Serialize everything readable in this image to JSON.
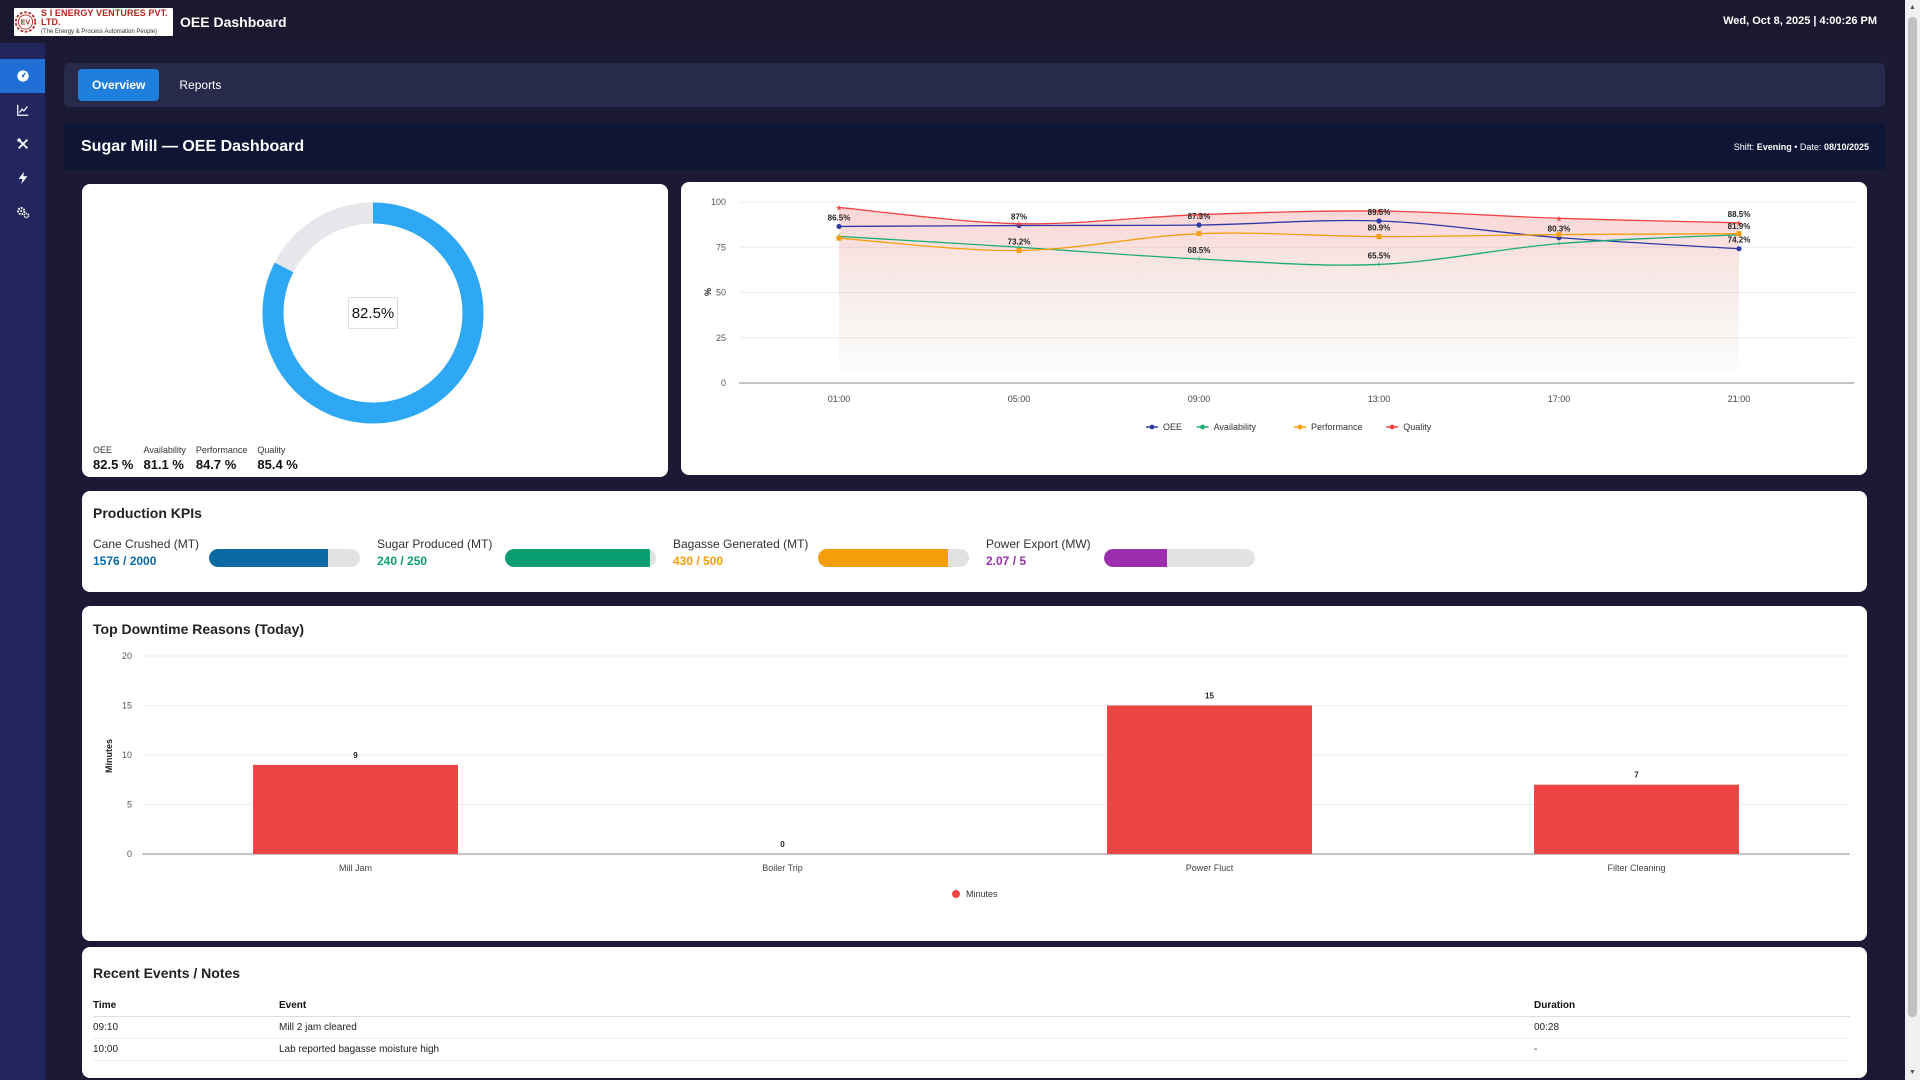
{
  "header": {
    "company_name": "S I ENERGY VENTURES PVT. LTD.",
    "company_tagline": "(The Energy & Process Automation People)",
    "logo_letters": "EV",
    "app_title": "OEE Dashboard",
    "datetime": "Wed, Oct 8, 2025 | 4:00:26 PM"
  },
  "sidebar": {
    "items": [
      {
        "icon": "dashboard-icon",
        "active": true
      },
      {
        "icon": "chart-line-icon",
        "active": false
      },
      {
        "icon": "tools-icon",
        "active": false
      },
      {
        "icon": "bolt-icon",
        "active": false
      },
      {
        "icon": "cogs-icon",
        "active": false
      }
    ]
  },
  "tabs": [
    {
      "label": "Overview",
      "active": true
    },
    {
      "label": "Reports",
      "active": false
    }
  ],
  "page": {
    "title": "Sugar Mill — OEE Dashboard",
    "shift_label": "Shift:",
    "shift_value": "Evening",
    "date_label": "• Date:",
    "date_value": "08/10/2025"
  },
  "gauge": {
    "value": 82.5,
    "value_text": "82.5%",
    "color": "#2ea8f5",
    "track_color": "#e5e7eb",
    "metrics": [
      {
        "label": "OEE",
        "value": "82.5 %"
      },
      {
        "label": "Availability",
        "value": "81.1 %"
      },
      {
        "label": "Performance",
        "value": "84.7 %"
      },
      {
        "label": "Quality",
        "value": "85.4 %"
      }
    ]
  },
  "kpis": {
    "title": "Production KPIs",
    "items": [
      {
        "label": "Cane Crushed (MT)",
        "value": "1576 / 2000",
        "current": 1576,
        "target": 2000,
        "color": "#0b6aa3"
      },
      {
        "label": "Sugar Produced (MT)",
        "value": "240 / 250",
        "current": 240,
        "target": 250,
        "color": "#0b9e73"
      },
      {
        "label": "Bagasse Generated (MT)",
        "value": "430 / 500",
        "current": 430,
        "target": 500,
        "color": "#f59e0b"
      },
      {
        "label": "Power Export (MW)",
        "value": "2.07 / 5",
        "current": 2.07,
        "target": 5,
        "color": "#9b2fae"
      }
    ]
  },
  "chart_data": [
    {
      "type": "line",
      "title": "",
      "xlabel": "",
      "ylabel": "%",
      "ylim": [
        0,
        100
      ],
      "yticks": [
        "0",
        "25",
        "50",
        "75",
        "100"
      ],
      "x": [
        "01:00",
        "05:00",
        "09:00",
        "13:00",
        "17:00",
        "21:00"
      ],
      "legend_position": "bottom",
      "grid": true,
      "series": [
        {
          "name": "OEE",
          "color": "#2f3aa6",
          "values": [
            86.5,
            87,
            87.3,
            89.5,
            80.3,
            74.2
          ]
        },
        {
          "name": "Availability",
          "color": "#1aab72",
          "values": [
            81,
            75,
            68.5,
            65.5,
            77,
            81.9
          ]
        },
        {
          "name": "Performance",
          "color": "#f59e0b",
          "values": [
            80,
            73.2,
            82.5,
            80.9,
            82,
            82.5
          ]
        },
        {
          "name": "Quality",
          "color": "#ef4444",
          "values": [
            97,
            88,
            93,
            95,
            91,
            88.5
          ]
        }
      ],
      "data_labels": [
        {
          "x": "01:00",
          "text": "86.5%"
        },
        {
          "x": "05:00",
          "text": "87%"
        },
        {
          "x": "05:00",
          "text": "73.2%"
        },
        {
          "x": "09:00",
          "text": "87.3%"
        },
        {
          "x": "09:00",
          "text": "68.5%"
        },
        {
          "x": "13:00",
          "text": "89.5%"
        },
        {
          "x": "13:00",
          "text": "80.9%"
        },
        {
          "x": "13:00",
          "text": "65.5%"
        },
        {
          "x": "17:00",
          "text": "80.3%"
        },
        {
          "x": "21:00",
          "text": "88.5%"
        },
        {
          "x": "21:00",
          "text": "81.9%"
        },
        {
          "x": "21:00",
          "text": "74.2%"
        }
      ]
    },
    {
      "type": "bar",
      "title": "Top Downtime Reasons (Today)",
      "xlabel": "",
      "ylabel": "Minutes",
      "ylim": [
        0,
        20
      ],
      "yticks": [
        "0",
        "5",
        "10",
        "15",
        "20"
      ],
      "categories": [
        "Mill Jam",
        "Boiler Trip",
        "Power Fluct",
        "Filter Cleaning"
      ],
      "series": [
        {
          "name": "Minutes",
          "color": "#ef4444",
          "values": [
            9,
            0,
            15,
            7
          ]
        }
      ],
      "legend_position": "bottom",
      "grid": true
    }
  ],
  "events": {
    "title": "Recent Events / Notes",
    "columns": [
      "Time",
      "Event",
      "Duration"
    ],
    "rows": [
      [
        "09:10",
        "Mill 2 jam cleared",
        "00:28"
      ],
      [
        "10:00",
        "Lab reported bagasse moisture high",
        "-"
      ]
    ]
  }
}
